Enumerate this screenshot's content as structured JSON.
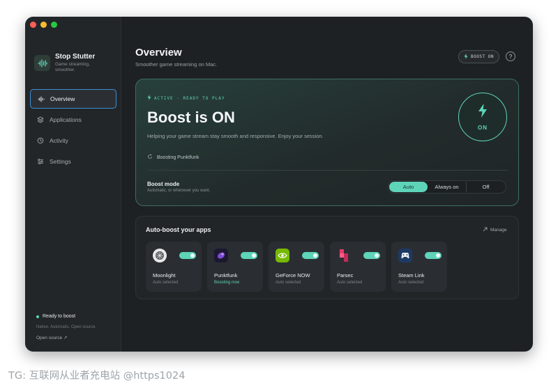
{
  "sidebar": {
    "app_name": "Stop Stutter",
    "tagline": "Game streaming, smoother.",
    "nav": [
      {
        "label": "Overview",
        "icon": "waveform-icon"
      },
      {
        "label": "Applications",
        "icon": "layers-icon"
      },
      {
        "label": "Activity",
        "icon": "clock-icon"
      },
      {
        "label": "Settings",
        "icon": "sliders-icon"
      }
    ],
    "status": "Ready to boost",
    "note": "Native. Automatic. Open source.",
    "open_source": "Open source ↗"
  },
  "header": {
    "title": "Overview",
    "subtitle": "Smoother game streaming on Mac.",
    "boost_pill": "BOOST ON",
    "help": "?"
  },
  "hero": {
    "status": "ACTIVE · READY TO PLAY",
    "title": "Boost is ON",
    "description": "Helping your game stream stay smooth and responsive. Enjoy your session.",
    "boosting": "Boosting Punktfunk",
    "mode_label": "Boost mode",
    "mode_description": "Automatic, or whenever you want.",
    "modes": [
      "Auto",
      "Always on",
      "Off"
    ],
    "selected_mode": "Auto",
    "ring_label": "ON"
  },
  "apps": {
    "title": "Auto-boost your apps",
    "manage": "Manage",
    "items": [
      {
        "name": "Moonlight",
        "status": "Auto selected",
        "enabled": true
      },
      {
        "name": "Punktfunk",
        "status": "Boosting now",
        "enabled": true
      },
      {
        "name": "GeForce NOW",
        "status": "Auto selected",
        "enabled": true
      },
      {
        "name": "Parsec",
        "status": "Auto selected",
        "enabled": true
      },
      {
        "name": "Steam Link",
        "status": "Auto selected",
        "enabled": true
      }
    ]
  },
  "colors": {
    "accent": "#5ed4b8",
    "window_bg": "#1e2124",
    "sidebar_bg": "#232629",
    "focus_ring": "#3d8fd6"
  },
  "watermark": "TG: 互联网从业者充电站 @https1024"
}
